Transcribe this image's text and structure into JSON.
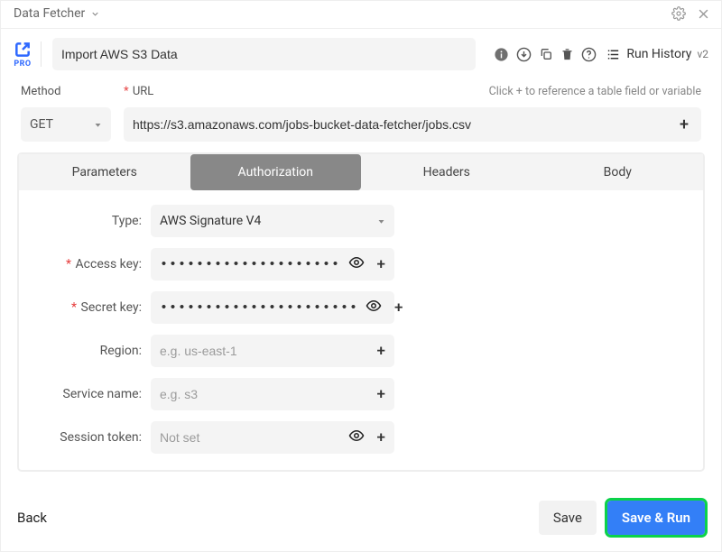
{
  "titlebar": {
    "title": "Data Fetcher"
  },
  "toolbar": {
    "pro_label": "PRO",
    "request_name": "Import AWS S3 Data",
    "run_history_label": "Run History",
    "version_label": "v2"
  },
  "request": {
    "method_label": "Method",
    "url_label": "URL",
    "hint": "Click + to reference a table field or variable",
    "method_value": "GET",
    "url_value": "https://s3.amazonaws.com/jobs-bucket-data-fetcher/jobs.csv"
  },
  "tabs": {
    "parameters": "Parameters",
    "authorization": "Authorization",
    "headers": "Headers",
    "body": "Body"
  },
  "auth": {
    "type_label": "Type:",
    "type_value": "AWS Signature V4",
    "access_key_label": "Access key:",
    "access_key_mask": "••••••••••••••••••••",
    "secret_key_label": "Secret key:",
    "secret_key_mask": "••••••••••••••••••••••",
    "region_label": "Region:",
    "region_placeholder": "e.g. us-east-1",
    "service_label": "Service name:",
    "service_placeholder": "e.g. s3",
    "session_label": "Session token:",
    "session_placeholder": "Not set"
  },
  "footer": {
    "back": "Back",
    "save": "Save",
    "save_run": "Save & Run"
  }
}
